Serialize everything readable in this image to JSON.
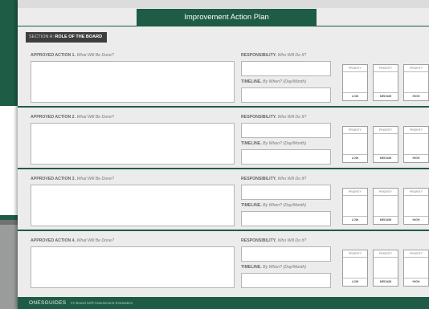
{
  "title": "Improvement Action Plan",
  "section": {
    "prefix": "SECTION A:",
    "name": "ROLE OF THE BOARD"
  },
  "actions": [
    {
      "label": "APPROVED ACTION 1.",
      "hint": "What Will Be Done?"
    },
    {
      "label": "APPROVED ACTION 2.",
      "hint": "What Will Be Done?"
    },
    {
      "label": "APPROVED ACTION 3.",
      "hint": "What Will Be Done?"
    },
    {
      "label": "APPROVED ACTION 4.",
      "hint": "What Will Be Done?"
    }
  ],
  "responsibility": {
    "label": "RESPONSIBILITY.",
    "hint": "Who Will Do It?"
  },
  "timeline": {
    "label": "TIMELINE.",
    "hint": "By When? (Day/Month)"
  },
  "priority": {
    "header": "PRIORITY",
    "levels": [
      "LOW",
      "MEDIUM",
      "HIGH"
    ]
  },
  "footer": {
    "brand": "ONESGUIDES",
    "subtitle": "#1 Board Self-Assessment Evaluation"
  },
  "colors": {
    "brand_green": "#1f5c45",
    "page": "#ececec",
    "section_label": "#3e3e3e"
  }
}
